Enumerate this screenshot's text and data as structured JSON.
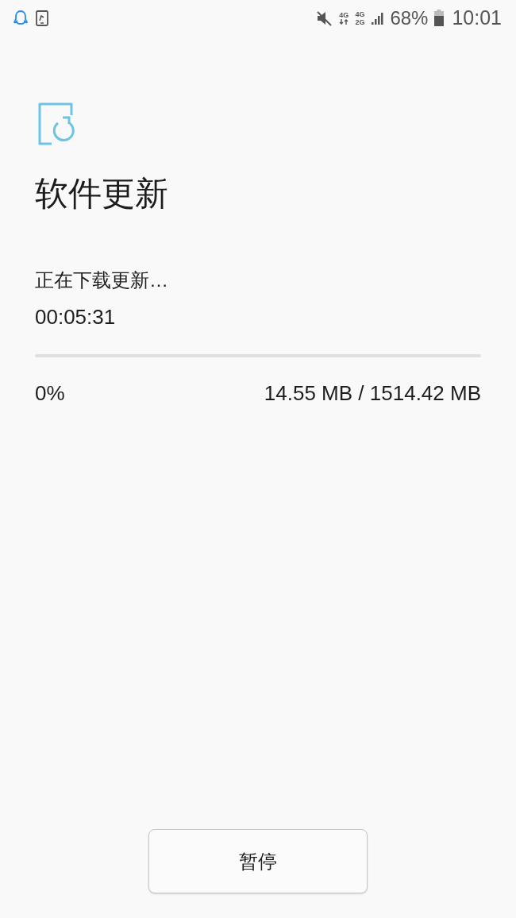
{
  "status_bar": {
    "network_1": "4G",
    "network_2": "4G",
    "network_3": "2G",
    "battery": "68%",
    "time": "10:01"
  },
  "title": "软件更新",
  "status": "正在下载更新…",
  "elapsed": "00:05:31",
  "progress": {
    "level": 0,
    "percent": "0%",
    "size": "14.55 MB / 1514.42 MB"
  },
  "button": "暂停"
}
